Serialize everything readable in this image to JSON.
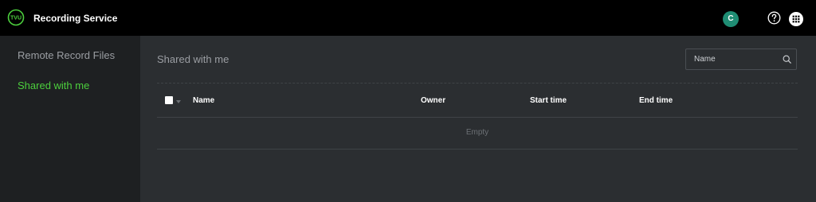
{
  "header": {
    "app_title": "Recording Service",
    "logo_text": "TVU",
    "avatar_initial": "C",
    "help_icon": "question-circle-icon",
    "apps_icon": "apps-grid-icon"
  },
  "sidebar": {
    "items": [
      {
        "label": "Remote Record Files",
        "active": false
      },
      {
        "label": "Shared with me",
        "active": true
      }
    ]
  },
  "main": {
    "title": "Shared with me",
    "search": {
      "placeholder": "Name",
      "value": "",
      "icon": "search-icon"
    },
    "table": {
      "columns": [
        "Name",
        "Owner",
        "Start time",
        "End time"
      ],
      "empty_text": "Empty"
    }
  },
  "colors": {
    "header_bg": "#000000",
    "sidebar_bg": "#1e2022",
    "main_bg": "#2b2e31",
    "accent_green": "#4ccf3d",
    "avatar_bg": "#1f8d74"
  }
}
